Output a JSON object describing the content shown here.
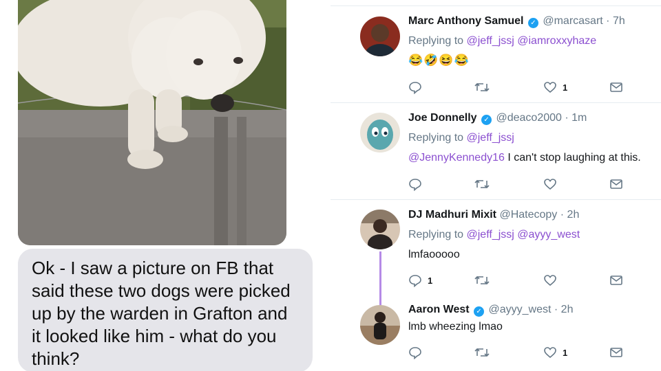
{
  "message": {
    "text": "Ok - I saw a picture on FB that said these two dogs were picked up by the warden in Grafton and it looked like him - what do you think?"
  },
  "colors": {
    "accent": "#1da1f2",
    "mention": "#8b4fd0",
    "bubble": "#e5e5ea",
    "thread": "#b58ae6"
  },
  "tweets": [
    {
      "name": "Marc Anthony Samuel",
      "handle": "@marcasart",
      "time": "· 7h",
      "replying_label": "Replying to",
      "replying_to": "@jeff_jssj @iamroxxyhaze",
      "body_mention": "",
      "body": "😂🤣😆😂",
      "reply_count": "",
      "like_count": "1"
    },
    {
      "name": "Joe Donnelly",
      "handle": "@deaco2000",
      "time": "· 1m",
      "replying_label": "Replying to",
      "replying_to": "@jeff_jssj",
      "body_mention": "@JennyKennedy16",
      "body": " I can't stop laughing at this.",
      "reply_count": "",
      "like_count": ""
    },
    {
      "name": "DJ Madhuri Mixit",
      "handle": "@Hatecopy",
      "time": "· 2h",
      "replying_label": "Replying to",
      "replying_to": "@jeff_jssj @ayyy_west",
      "body_mention": "",
      "body": "lmfaooooo",
      "reply_count": "1",
      "like_count": ""
    },
    {
      "name": "Aaron West",
      "handle": "@ayyy_west",
      "time": "· 2h",
      "replying_label": "",
      "replying_to": "",
      "body_mention": "",
      "body": "lmb wheezing lmao",
      "reply_count": "",
      "like_count": "1"
    }
  ],
  "icons": [
    "reply-icon",
    "retweet-icon",
    "like-icon",
    "share-icon",
    "verified-icon"
  ]
}
